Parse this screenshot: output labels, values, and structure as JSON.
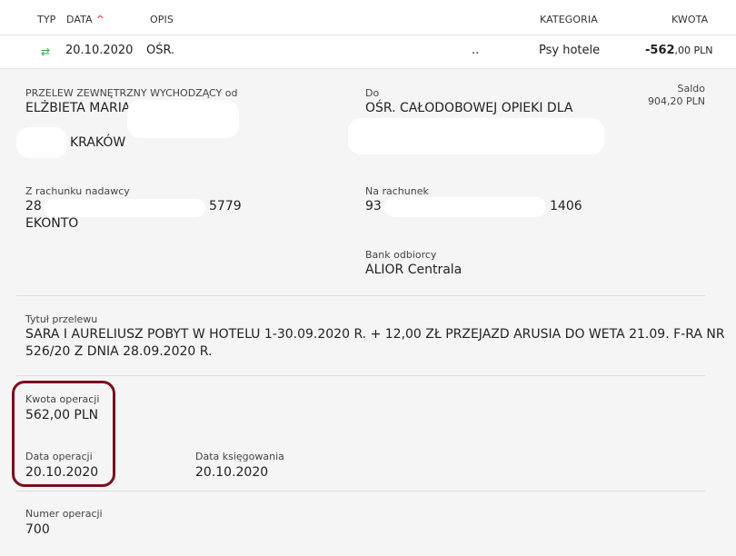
{
  "header": {
    "typ": "TYP",
    "data": "DATA",
    "opis": "OPIS",
    "kategoria": "KATEGORIA",
    "kwota": "KWOTA"
  },
  "row": {
    "date": "20.10.2020",
    "opis_start": "OŚR.",
    "opis_end": "..",
    "category": "Psy hotele",
    "amount_int": "-562",
    "amount_dec": ",00 PLN"
  },
  "details": {
    "sender_label": "PRZELEW ZEWNĘTRZNY WYCHODZĄCY od",
    "sender_name": "ELŻBIETA MARIA",
    "sender_city": "KRAKÓW",
    "to_label": "Do",
    "to_name": "OŚR. CAŁODOBOWEJ OPIEKI DLA",
    "saldo_label": "Saldo",
    "saldo_value": "904,20 PLN",
    "from_account_label": "Z rachunku nadawcy",
    "from_account_start": "28",
    "from_account_end": "5779",
    "from_account_name": "EKONTO",
    "to_account_label": "Na rachunek",
    "to_account_start": "93",
    "to_account_end": "1406",
    "bank_label": "Bank odbiorcy",
    "bank_value": "ALIOR Centrala",
    "title_label": "Tytuł przelewu",
    "title_line1": "SARA I AURELIUSZ POBYT W HOTELU 1-30.09.2020 R. + 12,00 ZŁ PRZEJAZD ARUSIA DO WETA 21.09. F-RA NR",
    "title_line2": "526/20 Z DNIA 28.09.2020 R.",
    "op_amount_label": "Kwota operacji",
    "op_amount_value": "562,00 PLN",
    "op_date_label": "Data operacji",
    "op_date_value": "20.10.2020",
    "book_date_label": "Data księgowania",
    "book_date_value": "20.10.2020",
    "op_number_label": "Numer operacji",
    "op_number_value": "700"
  },
  "colors": {
    "sort_arrow": "#d3202a",
    "transfer_icon": "#2ea84a",
    "highlight_border": "#7b0f1f"
  },
  "icons": {
    "transfer": "transfer-arrows-icon",
    "sort": "sort-up-icon"
  }
}
